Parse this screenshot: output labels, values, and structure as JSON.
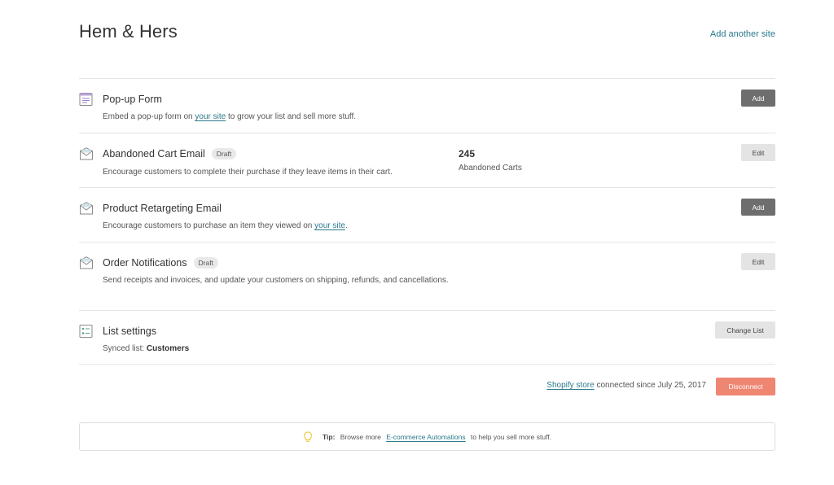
{
  "header": {
    "title": "Hem & Hers",
    "add_site_label": "Add another site"
  },
  "rows": {
    "popup": {
      "icon": "form-icon",
      "title": "Pop-up Form",
      "desc_before": "Embed a pop-up form on ",
      "desc_link": "your site",
      "desc_after": " to grow your list and sell more stuff.",
      "button": "Add"
    },
    "abandoned": {
      "icon": "email-icon",
      "title": "Abandoned Cart Email",
      "badge": "Draft",
      "desc": "Encourage customers to complete their purchase if they leave items in their cart.",
      "stat_value": "245",
      "stat_label": "Abandoned Carts",
      "button": "Edit"
    },
    "retargeting": {
      "icon": "email-icon",
      "title": "Product Retargeting Email",
      "desc_before": "Encourage customers to purchase an item they viewed on ",
      "desc_link": "your site",
      "desc_after": ".",
      "button": "Add"
    },
    "orders": {
      "icon": "email-icon",
      "title": "Order Notifications",
      "badge": "Draft",
      "desc": "Send receipts and invoices, and update your customers on shipping, refunds, and cancellations.",
      "button": "Edit"
    },
    "list": {
      "icon": "list-settings-icon",
      "title": "List settings",
      "desc_prefix": "Synced list: ",
      "desc_value": "Customers",
      "button": "Change List"
    }
  },
  "connection": {
    "store_link": "Shopify store",
    "text": " connected since July 25, 2017",
    "button": "Disconnect"
  },
  "tip": {
    "label": "Tip:",
    "text_before": " Browse more ",
    "link": "E-commerce Automations",
    "text_after": " to help you sell more stuff."
  },
  "colors": {
    "link": "#2a7a8c",
    "disconnect": "#ee8672",
    "dark_button": "#6e6e6e",
    "bulb": "#f2c94c"
  }
}
